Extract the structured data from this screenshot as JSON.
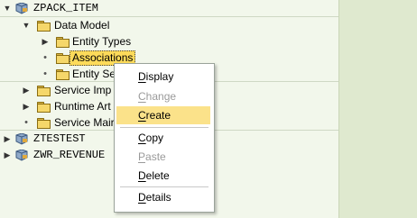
{
  "tree": {
    "root": {
      "label": "ZPACK_ITEM",
      "expanded": true
    },
    "data_model": {
      "label": "Data Model",
      "expanded": true
    },
    "entity_types": {
      "label": "Entity Types"
    },
    "associations": {
      "label": "Associations",
      "selected": true
    },
    "entity_sets": {
      "label": "Entity Se"
    },
    "service_impl": {
      "label": "Service Imp"
    },
    "runtime_art": {
      "label": "Runtime Art"
    },
    "service_maint": {
      "label": "Service Mair"
    },
    "ztestest": {
      "label": "ZTESTEST"
    },
    "zwr_revenue": {
      "label": "ZWR_REVENUE"
    }
  },
  "context_menu": {
    "items": [
      {
        "label": "Display",
        "mnemonic_index": 0,
        "enabled": true
      },
      {
        "label": "Change",
        "mnemonic_index": 0,
        "enabled": false
      },
      {
        "label": "Create",
        "mnemonic_index": 0,
        "enabled": true,
        "highlighted": true
      },
      {
        "label": "Copy",
        "mnemonic_index": 0,
        "enabled": true
      },
      {
        "label": "Paste",
        "mnemonic_index": 0,
        "enabled": false
      },
      {
        "label": "Delete",
        "mnemonic_index": 0,
        "enabled": true
      },
      {
        "label": "Details",
        "mnemonic_index": 0,
        "enabled": true
      }
    ]
  },
  "colors": {
    "highlight": "#fbe28a",
    "selection": "#fddb5a",
    "background": "#f2f7eb"
  }
}
